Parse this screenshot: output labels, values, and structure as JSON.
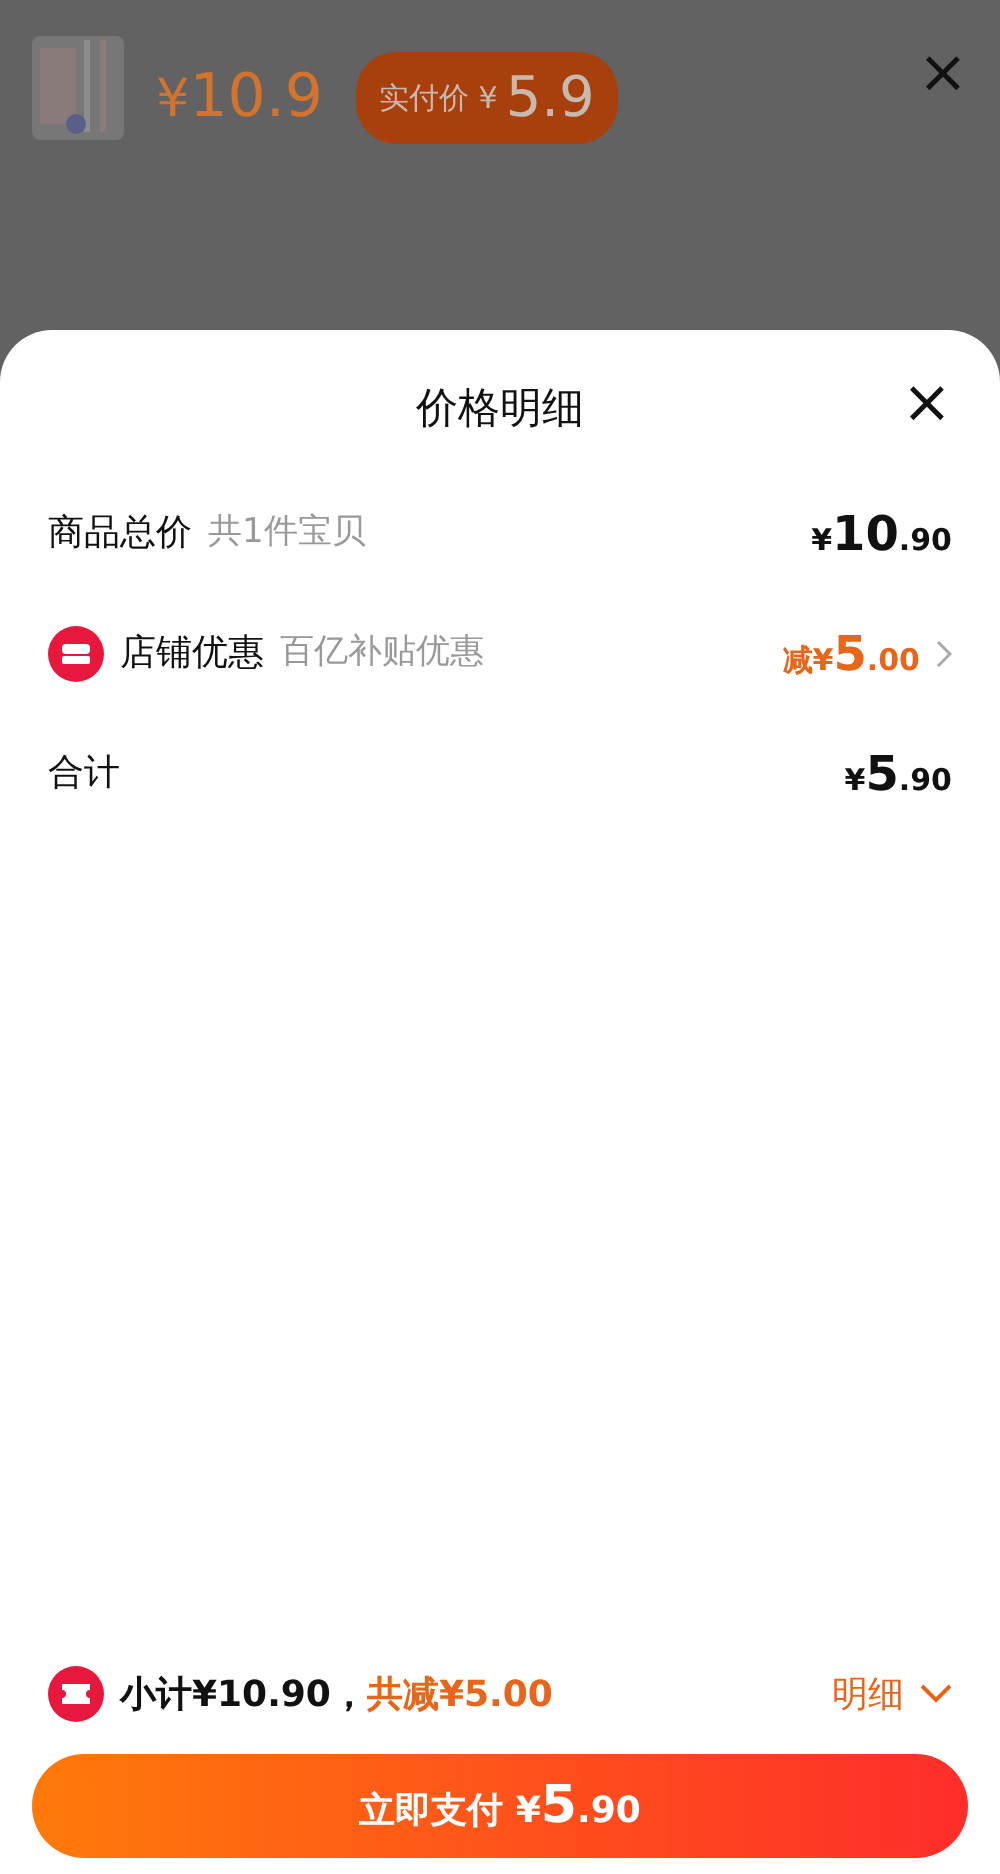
{
  "background": {
    "price": {
      "currency": "¥",
      "amount": "10.9"
    },
    "paid_badge": {
      "label": "实付价",
      "currency": "¥",
      "amount": "5.9"
    },
    "close": "×"
  },
  "sheet": {
    "title": "价格明细",
    "close": "×",
    "rows": [
      {
        "kind": "plain",
        "label": "商品总价",
        "note": "共1件宝贝",
        "price": {
          "currency": "¥",
          "integer": "10",
          "decimal": ".90"
        },
        "highlight": false,
        "chevron": false
      },
      {
        "kind": "icon",
        "label": "店铺优惠",
        "note": "百亿补贴优惠",
        "price": {
          "prefix": "减",
          "currency": "¥",
          "integer": "5",
          "decimal": ".00"
        },
        "highlight": true,
        "chevron": true
      },
      {
        "kind": "plain",
        "label": "合计",
        "price": {
          "currency": "¥",
          "integer": "5",
          "decimal": ".90"
        },
        "highlight": false,
        "chevron": false
      }
    ]
  },
  "footer": {
    "subtotal": "小计¥10.90，",
    "discount": "共减¥5.00",
    "details": "明细",
    "expanded": true,
    "pay_button": {
      "label": "立即支付",
      "currency": "¥",
      "integer": "5",
      "decimal": ".90"
    }
  }
}
